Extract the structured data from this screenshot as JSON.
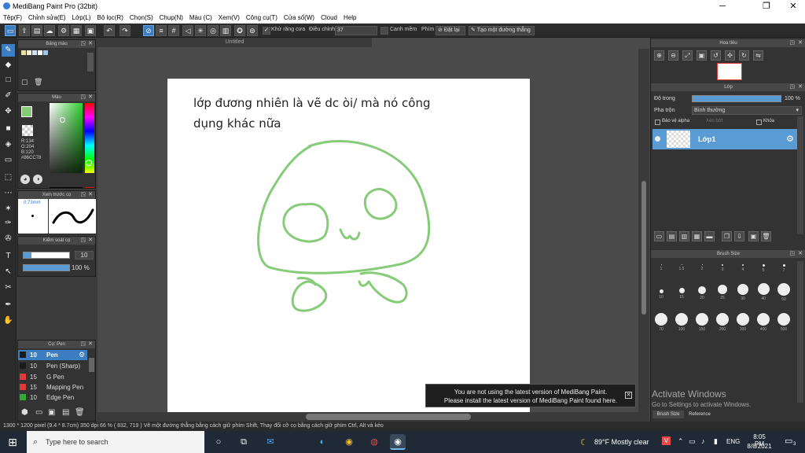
{
  "window": {
    "title": "MediBang Paint Pro (32bit)",
    "controls": [
      "─",
      "❐",
      "✕"
    ]
  },
  "menu": {
    "items": [
      "Tệp(F)",
      "Chỉnh sửa(E)",
      "Lớp(L)",
      "Bộ lọc(R)",
      "Chọn(S)",
      "Chụp(N)",
      "Màu (C)",
      "Xem(V)",
      "Công cụ(T)",
      "Cửa sổ(W)",
      "Cloud",
      "Help"
    ]
  },
  "toolbar": {
    "antialias_label": "Khử răng cưa",
    "adjust_label": "Điều chỉnh",
    "adjust_value": "37",
    "hand_correction_label": "Canh mềm",
    "key_label": "Phím",
    "cancel_label": "Đặt lại",
    "line_label": "Tạo một đường thẳng"
  },
  "panels": {
    "palette_title": "Bảng màu",
    "color_title": "Màu",
    "color_values": {
      "r": "R:134",
      "g": "G:204",
      "b": "B:120",
      "hex": "#86CC78"
    },
    "brush_preview_title": "Xem trước cọ",
    "brush_preview_size": "0.73mm",
    "brush_control_title": "Kiểm soát cọ",
    "brush_size_value": "10",
    "brush_opacity_value": "100 %",
    "brush_list_title": "Cọ: Pen",
    "brushes": [
      {
        "size": "10",
        "name": "Pen",
        "color": "#1a1a1a",
        "selected": true
      },
      {
        "size": "10",
        "name": "Pen (Sharp)",
        "color": "#1a1a1a",
        "selected": false
      },
      {
        "size": "15",
        "name": "G Pen",
        "color": "#e03a3a",
        "selected": false
      },
      {
        "size": "15",
        "name": "Mapping Pen",
        "color": "#e03a3a",
        "selected": false
      },
      {
        "size": "10",
        "name": "Edge Pen",
        "color": "#33aa33",
        "selected": false
      }
    ]
  },
  "canvas": {
    "tab_title": "Untitled",
    "text_lines": [
      "lớp đương nhiên là vẽ dc òi/ mà nó công",
      "dụng khác nữa"
    ],
    "stroke_color": "#86CC78"
  },
  "notification": {
    "line1": "You are not using the latest version of MediBang Paint.",
    "line2": "Please install the latest version of MediBang Paint found here."
  },
  "right": {
    "navigator_title": "Hoa tiêu",
    "layer_title": "Lớp",
    "opacity_label": "Độ trong",
    "opacity_value": "100 %",
    "blend_label": "Pha trộn",
    "blend_value": "Bình thường",
    "protect_alpha_label": "Bảo vệ alpha",
    "clipping_label": "Xén bớt",
    "lock_label": "Khóa",
    "layer_name": "Lớp1",
    "brush_size_title": "Brush Size",
    "brush_sizes": [
      "1",
      "1.5",
      "2",
      "3",
      "4",
      "5",
      "7",
      "10",
      "15",
      "20",
      "25",
      "30",
      "40",
      "50",
      "70",
      "100",
      "150",
      "200",
      "300",
      "400",
      "500",
      "1000"
    ],
    "tab_brush_size": "Brush Size",
    "tab_reference": "Reference"
  },
  "status": {
    "text": "1300 * 1200 pixel   (9.4 * 8.7cm)   350 dpi   66 %   ( 832, 719 )   Vẽ một đường thẳng bằng cách giữ phím Shift, Thay đổi cỡ cọ bằng cách giữ phím Ctrl, Alt và kéo"
  },
  "watermark": {
    "line1": "Activate Windows",
    "line2": "Go to Settings to activate Windows."
  },
  "taskbar": {
    "search_placeholder": "Type here to search",
    "weather": "89°F  Mostly clear",
    "language": "ENG",
    "time": "8:05 PM",
    "date": "8/8/2021",
    "notification_count": "3"
  }
}
